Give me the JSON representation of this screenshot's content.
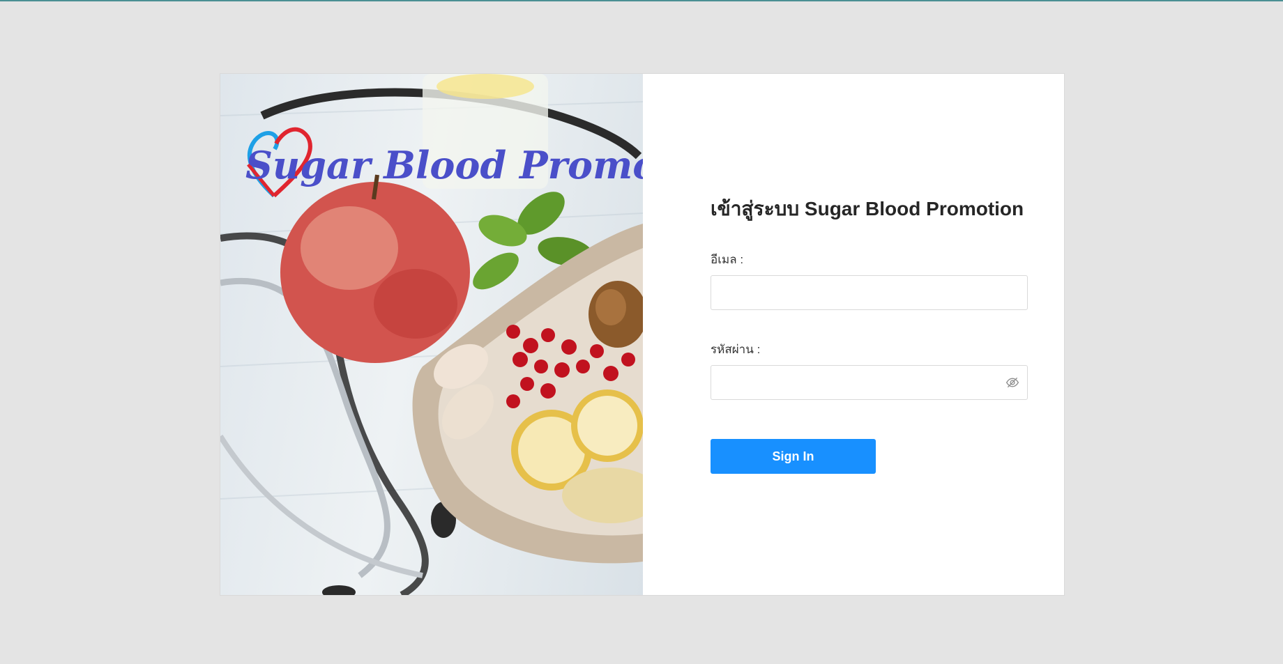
{
  "hero": {
    "logo_text": "Sugar Blood Promotion",
    "image_description_icon": "healthy-food-stethoscope-photo"
  },
  "login": {
    "title": "เข้าสู่ระบบ Sugar Blood Promotion",
    "email_label": "อีเมล :",
    "email_value": "",
    "password_label": "รหัสผ่าน :",
    "password_value": "",
    "password_toggle_icon": "eye-invisible-icon",
    "submit_label": "Sign In"
  },
  "colors": {
    "accent": "#1890ff",
    "page_bg": "#e4e4e4",
    "logo_text": "#4a4fc9",
    "heart_red": "#e0252f",
    "heart_blue": "#1ea0e6"
  }
}
